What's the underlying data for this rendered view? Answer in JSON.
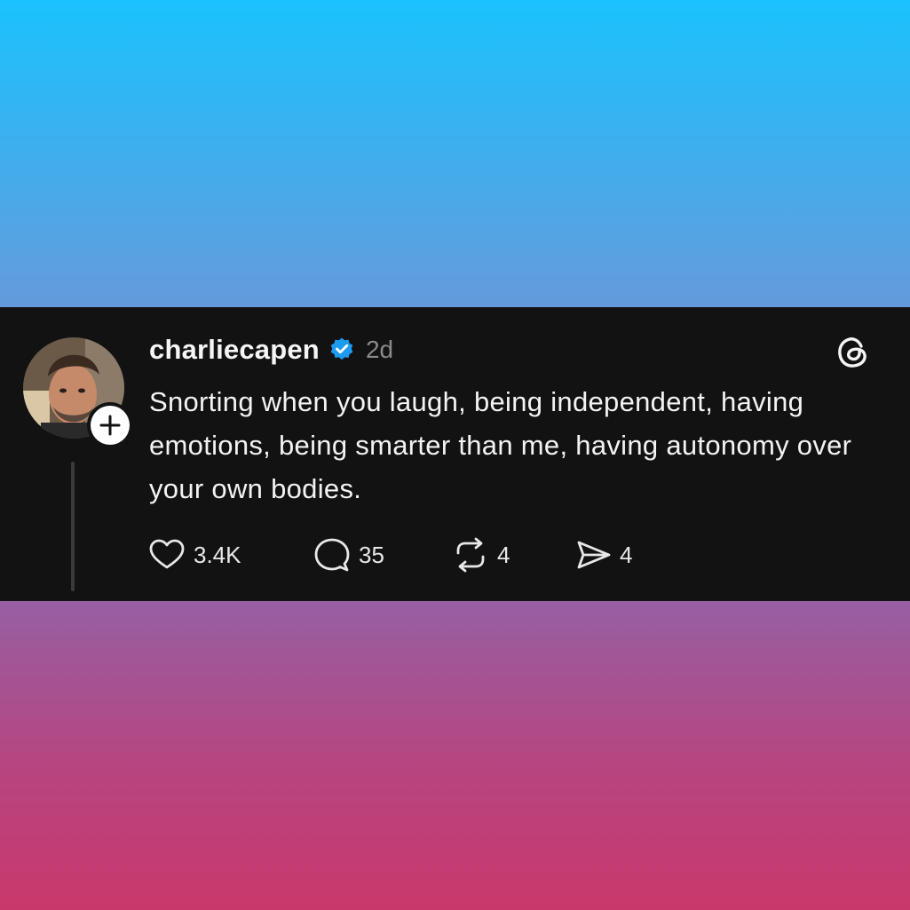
{
  "post": {
    "username": "charliecapen",
    "timestamp": "2d",
    "text": "Snorting when you laugh, being independent, having emotions, being smarter than me, having autonomy over your own bodies.",
    "likes": "3.4K",
    "replies": "35",
    "reposts": "4",
    "shares": "4"
  },
  "icons": {
    "verified": "verified-badge-icon",
    "follow": "plus-icon",
    "brand": "threads-logo-icon",
    "like": "heart-icon",
    "reply": "comment-icon",
    "repost": "repost-icon",
    "share": "send-icon"
  },
  "colors": {
    "card_background": "#121212",
    "verified_blue": "#1d9bf0",
    "gradient_top": "#1ac2fe",
    "gradient_bottom": "#c9386b"
  }
}
